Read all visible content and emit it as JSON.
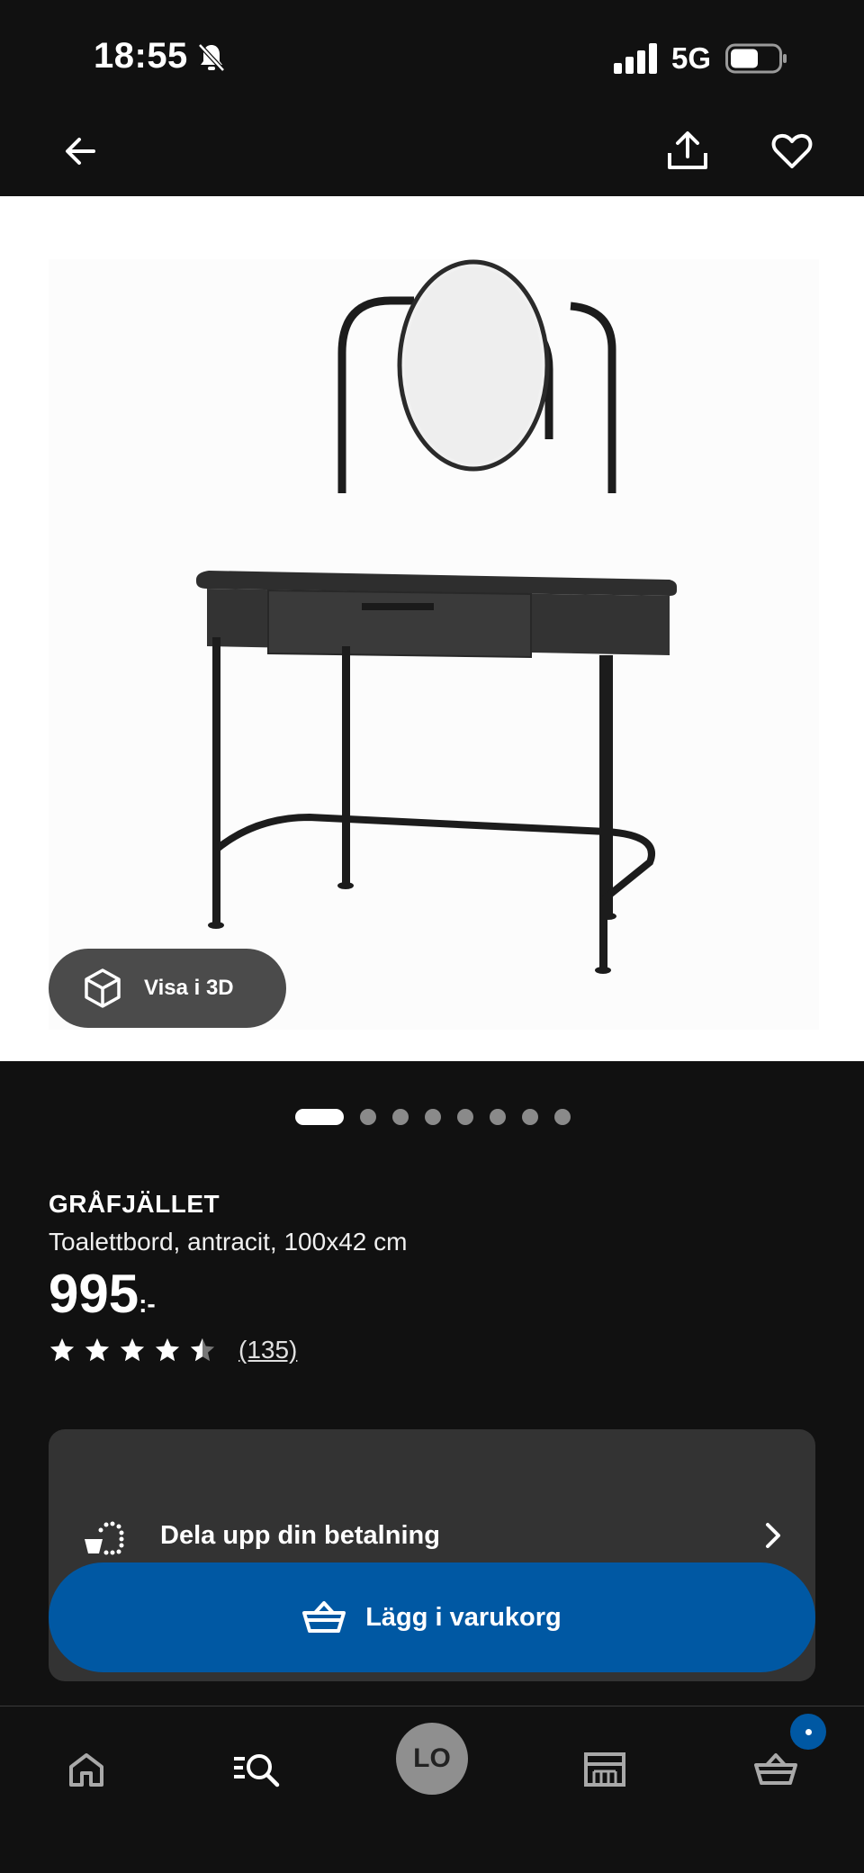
{
  "status_bar": {
    "time": "18:55",
    "network": "5G"
  },
  "nav": {
    "back_icon": "arrow-left-icon",
    "share_icon": "share-icon",
    "favorite_icon": "heart-icon"
  },
  "hero": {
    "view_3d_label": "Visa i 3D",
    "view_3d_icon": "cube-icon"
  },
  "carousel": {
    "total": 8,
    "active_index": 0
  },
  "product": {
    "name": "GRÅFJÄLLET",
    "description": "Toalettbord, antracit, 100x42 cm",
    "price": "995",
    "price_suffix": ":-",
    "rating": 4.5,
    "review_count": "(135)"
  },
  "payment": {
    "label": "Dela upp din betalning",
    "icon": "installment-icon"
  },
  "cta": {
    "add_to_cart_label": "Lägg i varukorg",
    "icon": "basket-icon"
  },
  "tab_bar": {
    "avatar_initials": "LO",
    "tabs": [
      "home-icon",
      "search-icon",
      "avatar",
      "store-icon",
      "cart-icon"
    ]
  },
  "colors": {
    "background": "#111111",
    "accent_blue": "#0058a3",
    "card": "#333333"
  }
}
